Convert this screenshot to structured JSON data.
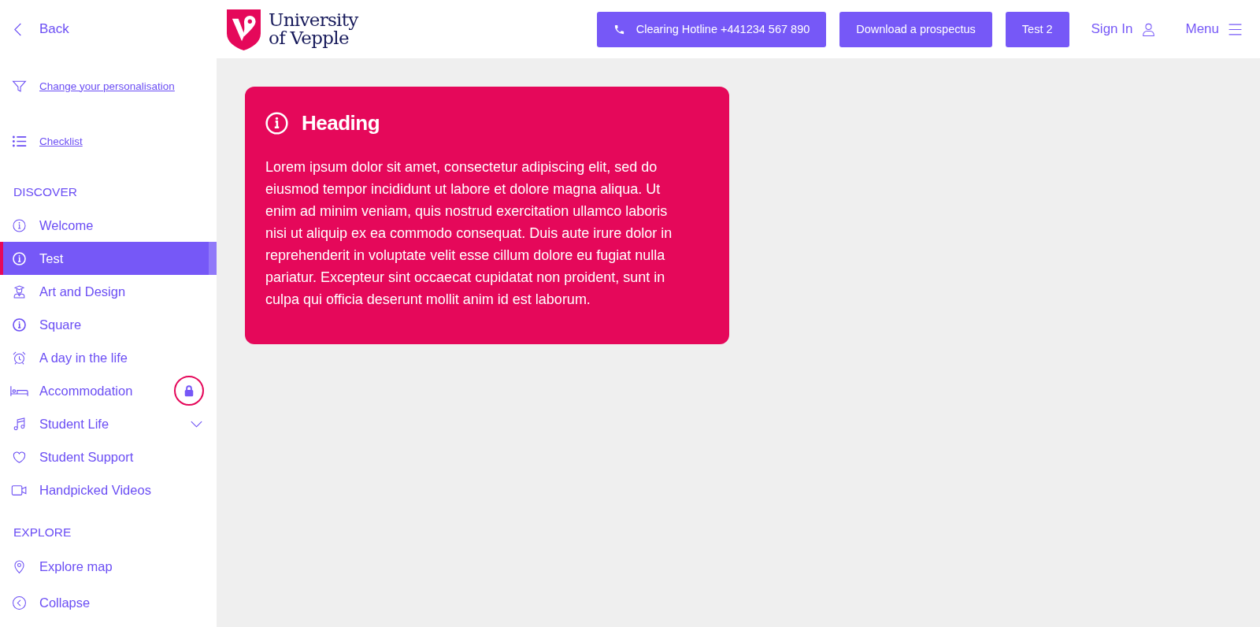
{
  "sidebar": {
    "back": "Back",
    "links": [
      "Change your personalisation",
      "Checklist"
    ],
    "sections": [
      {
        "title": "DISCOVER",
        "items": [
          {
            "label": "Welcome",
            "selected": false,
            "locked": false
          },
          {
            "label": "Test",
            "selected": true,
            "locked": false
          },
          {
            "label": "Art and Design",
            "selected": false,
            "locked": false
          },
          {
            "label": "Square",
            "selected": false,
            "locked": false
          },
          {
            "label": "A day in the life",
            "selected": false,
            "locked": false
          },
          {
            "label": "Accommodation",
            "selected": false,
            "locked": true
          },
          {
            "label": "Student Life",
            "selected": false,
            "locked": false,
            "expanded": false
          },
          {
            "label": "Student Support",
            "selected": false,
            "locked": false
          },
          {
            "label": "Handpicked Videos",
            "selected": false,
            "locked": false
          }
        ]
      },
      {
        "title": "EXPLORE",
        "items": [
          {
            "label": "Explore map",
            "selected": false,
            "locked": false
          }
        ]
      }
    ],
    "collapse": "Collapse"
  },
  "header": {
    "logo": [
      "University",
      "of Vepple"
    ],
    "buttons": [
      "Clearing Hotline +441234 567 890",
      "Download a prospectus",
      "Test 2"
    ],
    "links": [
      "Sign In",
      "Menu"
    ]
  },
  "card": {
    "heading": "Heading",
    "body": "Lorem ipsum dolor sit amet, consectetur adipiscing elit, sed do eiusmod tempor incididunt ut labore et dolore magna aliqua. Ut enim ad minim veniam, quis nostrud exercitation ullamco laboris nisi ut aliquip ex ea commodo consequat. Duis aute irure dolor in reprehenderit in voluptate velit esse cillum dolore eu fugiat nulla pariatur. Excepteur sint occaecat cupidatat non proident, sunt in culpa qui officia deserunt mollit anim id est laborum."
  }
}
